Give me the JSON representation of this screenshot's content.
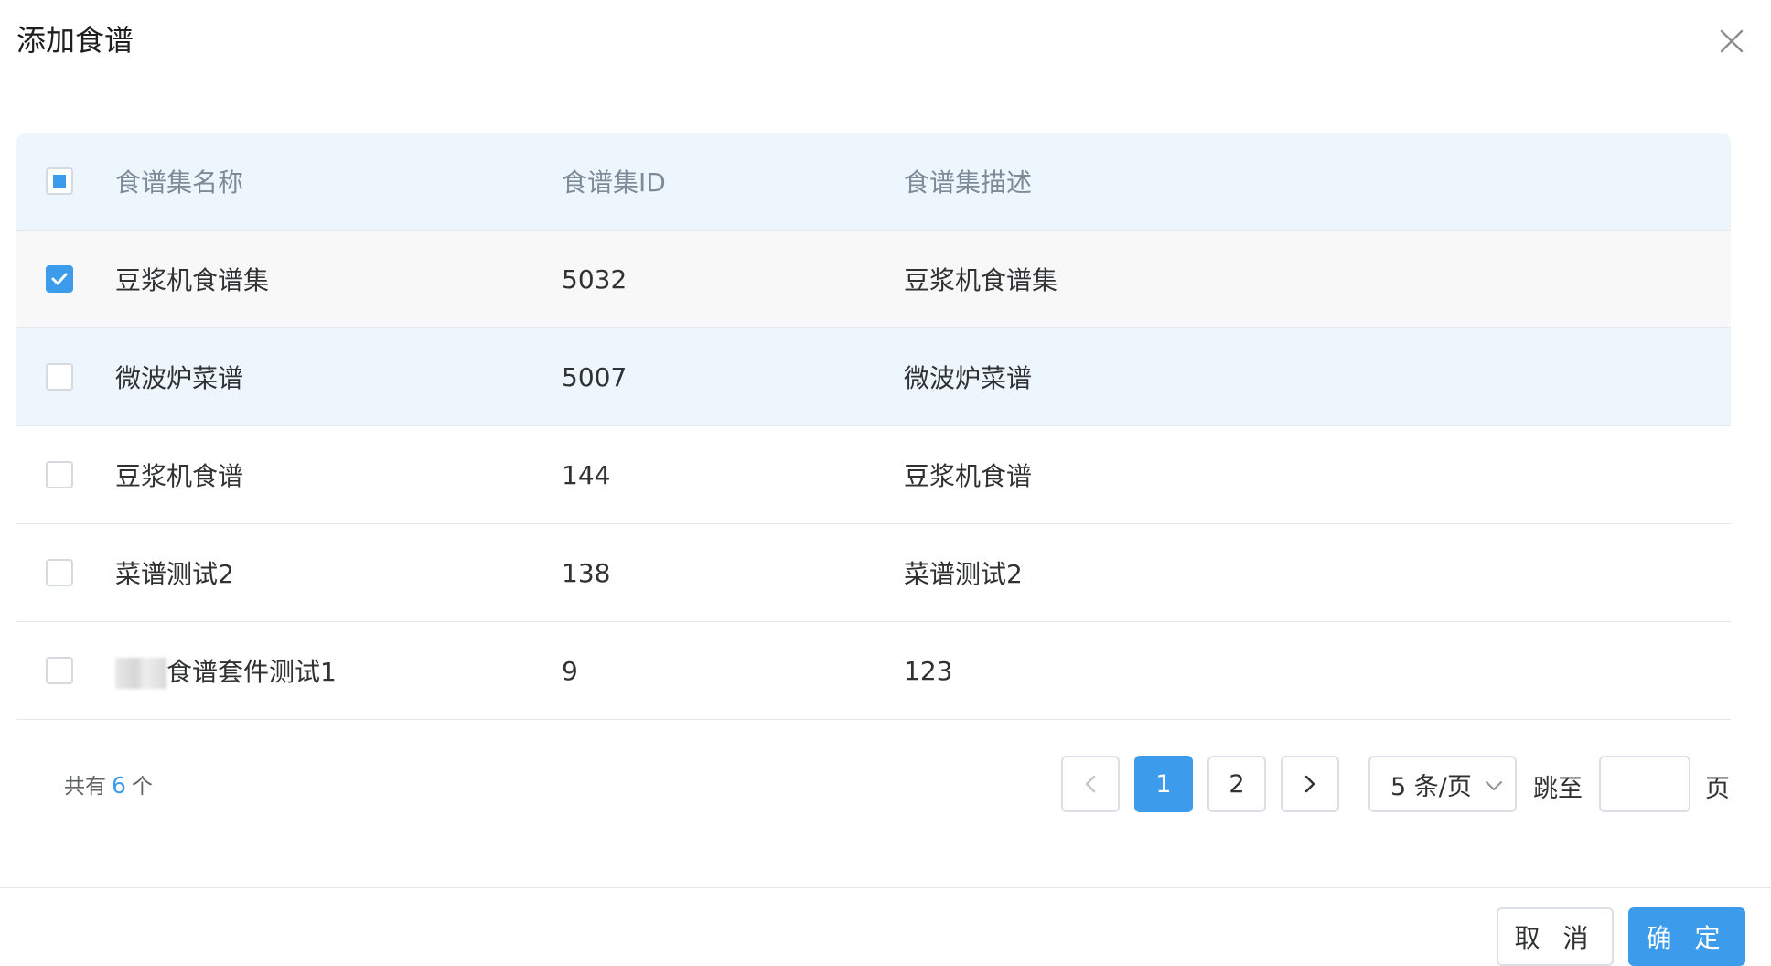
{
  "dialog": {
    "title": "添加食谱",
    "close_icon": "close-icon"
  },
  "table": {
    "headers": {
      "name": "食谱集名称",
      "id": "食谱集ID",
      "desc": "食谱集描述"
    },
    "header_checkbox_state": "indeterminate",
    "rows": [
      {
        "name": "豆浆机食谱集",
        "id": "5032",
        "desc": "豆浆机食谱集",
        "checked": true
      },
      {
        "name": "微波炉菜谱",
        "id": "5007",
        "desc": "微波炉菜谱",
        "checked": false
      },
      {
        "name": "豆浆机食谱",
        "id": "144",
        "desc": "豆浆机食谱",
        "checked": false
      },
      {
        "name": "菜谱测试2",
        "id": "138",
        "desc": "菜谱测试2",
        "checked": false
      },
      {
        "name": "食谱套件测试1",
        "id": "9",
        "desc": "123",
        "checked": false
      }
    ]
  },
  "pagination": {
    "total_prefix": "共有",
    "total_count": "6",
    "total_suffix": "个",
    "prev_icon": "chevron-left-icon",
    "pages": [
      "1",
      "2"
    ],
    "current_page": "1",
    "next_icon": "chevron-right-icon",
    "page_size": "5 条/页",
    "jump_label": "跳至",
    "jump_value": "",
    "page_suffix": "页"
  },
  "footer": {
    "cancel_label": "取 消",
    "confirm_label": "确 定"
  },
  "colors": {
    "accent": "#3d9bec",
    "header_bg": "#eef6fd",
    "border": "#dcdfe6"
  }
}
